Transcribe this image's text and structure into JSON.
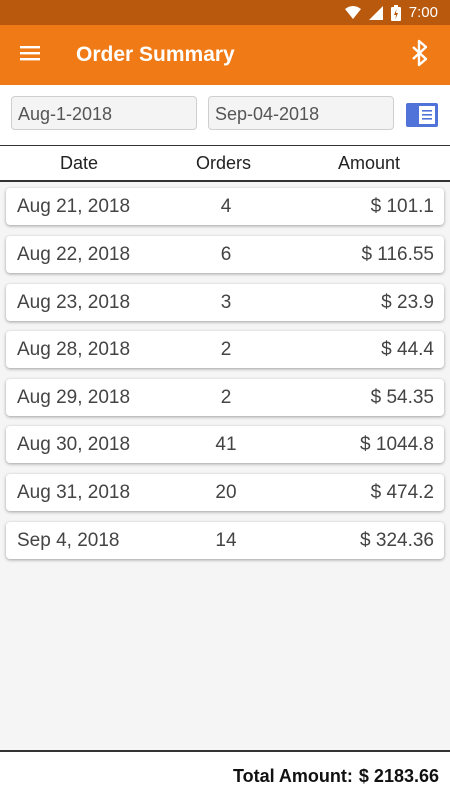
{
  "status_bar": {
    "time": "7:00"
  },
  "app_bar": {
    "title": "Order Summary"
  },
  "filters": {
    "from_date": "Aug-1-2018",
    "to_date": "Sep-04-2018"
  },
  "table": {
    "headers": {
      "date": "Date",
      "orders": "Orders",
      "amount": "Amount"
    },
    "rows": [
      {
        "date": "Aug 21, 2018",
        "orders": "4",
        "amount": "$ 101.1"
      },
      {
        "date": "Aug 22, 2018",
        "orders": "6",
        "amount": "$ 116.55"
      },
      {
        "date": "Aug 23, 2018",
        "orders": "3",
        "amount": "$ 23.9"
      },
      {
        "date": "Aug 28, 2018",
        "orders": "2",
        "amount": "$ 44.4"
      },
      {
        "date": "Aug 29, 2018",
        "orders": "2",
        "amount": "$ 54.35"
      },
      {
        "date": "Aug 30, 2018",
        "orders": "41",
        "amount": "$ 1044.8"
      },
      {
        "date": "Aug 31, 2018",
        "orders": "20",
        "amount": "$ 474.2"
      },
      {
        "date": "Sep 4, 2018",
        "orders": "14",
        "amount": "$ 324.36"
      }
    ]
  },
  "footer": {
    "total_label": "Total Amount:",
    "total_value": "$ 2183.66"
  },
  "icons": {
    "status": [
      "wifi-icon",
      "signal-icon",
      "battery-icon"
    ],
    "menu": "hamburger-menu-icon",
    "bluetooth": "bluetooth-icon",
    "filter": "list-view-icon"
  },
  "colors": {
    "accent": "#f07a16",
    "status_bar": "#b8590e",
    "filter_button": "#4f73d9"
  }
}
